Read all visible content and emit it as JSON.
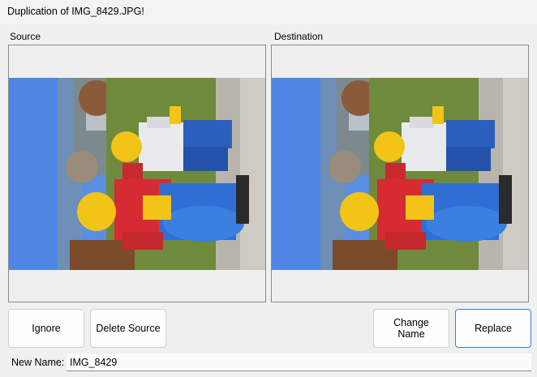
{
  "window": {
    "title": "Duplication of IMG_8429.JPG!"
  },
  "source": {
    "label": "Source",
    "image_alt": "Photo of large inflatable toy figures on a lawn"
  },
  "destination": {
    "label": "Destination",
    "image_alt": "Photo of large inflatable toy figures on a lawn"
  },
  "buttons": {
    "ignore": "Ignore",
    "delete_source": "Delete Source",
    "change_name": "Change Name",
    "replace": "Replace"
  },
  "new_name": {
    "label": "New Name:",
    "value": "IMG_8429"
  }
}
